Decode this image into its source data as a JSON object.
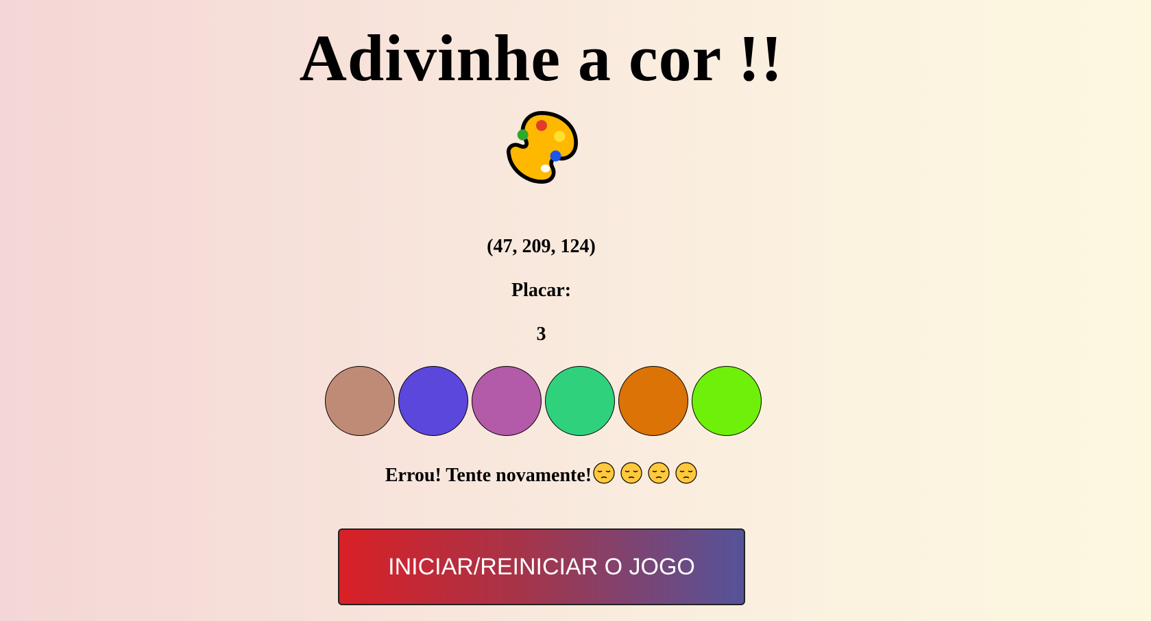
{
  "page": {
    "title": "Adivinhe a cor !!",
    "title_icon": "artist-palette-icon"
  },
  "game": {
    "target_rgb": "(47, 209, 124)",
    "score_label": "Placar:",
    "score_value": "3",
    "options": [
      {
        "color": "#c08b76"
      },
      {
        "color": "#5b47dc"
      },
      {
        "color": "#b35aa8"
      },
      {
        "color": "#2fd17c"
      },
      {
        "color": "#db7306"
      },
      {
        "color": "#6ff00a"
      }
    ],
    "message": "Errou! Tente novamente!",
    "message_icons": [
      "pensive-face-icon",
      "pensive-face-icon",
      "pensive-face-icon",
      "pensive-face-icon"
    ]
  },
  "controls": {
    "start_button_label": "INICIAR/REINICIAR O JOGO"
  },
  "colors": {
    "button_gradient_start": "#d92026",
    "button_gradient_end": "#55539a",
    "background_left": "#f4d6d6",
    "background_right": "#fcf8e0"
  }
}
